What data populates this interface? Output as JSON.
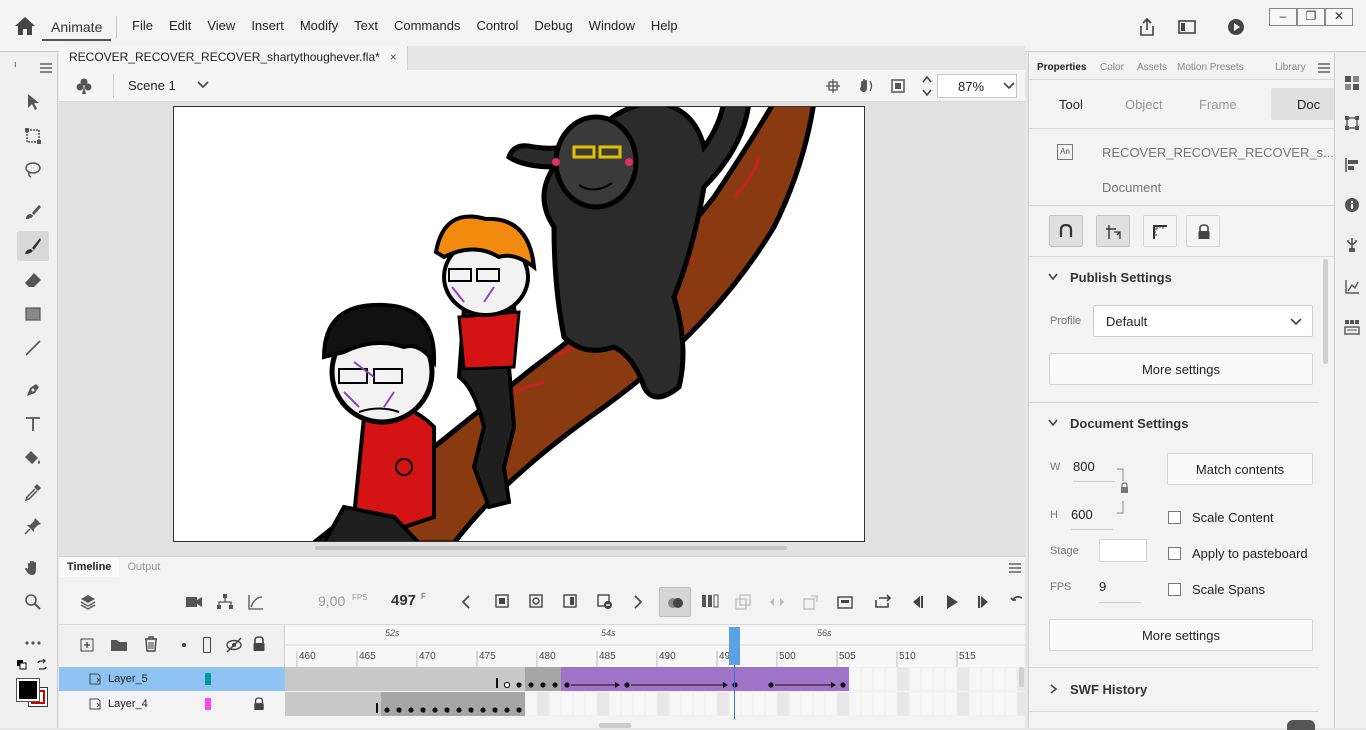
{
  "app": {
    "name": "Animate",
    "menus": [
      "File",
      "Edit",
      "View",
      "Insert",
      "Modify",
      "Text",
      "Commands",
      "Control",
      "Debug",
      "Window",
      "Help"
    ]
  },
  "document": {
    "tab_title": "RECOVER_RECOVER_RECOVER_shartythoughever.fla*",
    "tab_close": "×",
    "scene": "Scene 1",
    "zoom": "87%"
  },
  "timeline": {
    "tabs": [
      "Timeline",
      "Output"
    ],
    "fps": "9,00",
    "fps_unit": "FPS",
    "frame": "497",
    "frame_unit": "F",
    "time_markers": [
      "52s",
      "54s",
      "56s"
    ],
    "frame_numbers": [
      "460",
      "465",
      "470",
      "475",
      "480",
      "485",
      "490",
      "495",
      "500",
      "505",
      "510",
      "515"
    ],
    "layers": [
      {
        "name": "Layer_5",
        "color": "#00999a",
        "selected": true,
        "locked": false
      },
      {
        "name": "Layer_4",
        "color": "#ff44ee",
        "selected": false,
        "locked": true
      }
    ]
  },
  "properties": {
    "tabs": [
      "Properties",
      "Color",
      "Assets",
      "Motion Presets",
      "Library"
    ],
    "subtabs": [
      "Tool",
      "Object",
      "Frame",
      "Doc"
    ],
    "doc_name": "RECOVER_RECOVER_RECOVER_s...",
    "doc_type": "Document",
    "publish": {
      "title": "Publish Settings",
      "profile_label": "Profile",
      "profile_value": "Default",
      "more_settings": "More settings"
    },
    "docsettings": {
      "title": "Document Settings",
      "w_label": "W",
      "w_value": "800",
      "h_label": "H",
      "h_value": "600",
      "match_contents": "Match contents",
      "scale_content": "Scale Content",
      "apply_pasteboard": "Apply to pasteboard",
      "scale_spans": "Scale Spans",
      "stage_label": "Stage",
      "fps_label": "FPS",
      "fps_value": "9",
      "more_settings": "More settings",
      "stage_color": "#ffffff"
    },
    "swf_history": "SWF History"
  }
}
